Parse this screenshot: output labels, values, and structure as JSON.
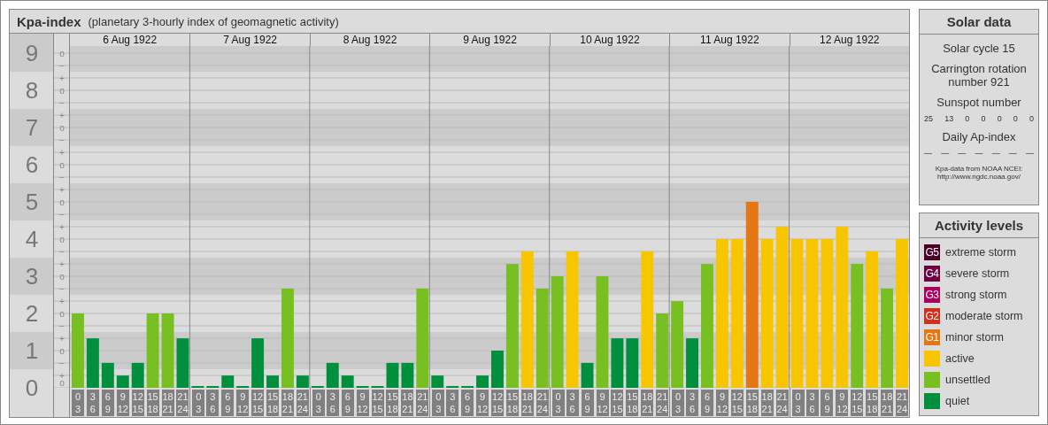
{
  "main": {
    "subtitle": "(planetary 3-hourly index of geomagnetic activity)",
    "days": [
      {
        "date": "6 Aug 1922"
      },
      {
        "date": "7 Aug 1922"
      },
      {
        "date": "8 Aug 1922"
      },
      {
        "date": "9 Aug 1922"
      },
      {
        "date": "10 Aug 1922"
      },
      {
        "date": "11 Aug 1922"
      },
      {
        "date": "12 Aug 1922"
      }
    ],
    "minor_ticks": [
      "o",
      "−",
      "+",
      "o",
      "−",
      "+",
      "o",
      "−",
      "+",
      "o",
      "−",
      "+",
      "o",
      "−",
      "+",
      "o",
      "−",
      "+",
      "o",
      "−",
      "+",
      "o",
      "−",
      "+",
      "o",
      "−",
      "+",
      "o"
    ],
    "chart_data": {
      "type": "bar",
      "title": "Kpa-index",
      "ylim": [
        0,
        9.19
      ],
      "yticks": [
        0,
        1,
        2,
        3,
        4,
        5,
        6,
        7,
        8,
        9
      ],
      "grid": true,
      "categories": [
        "0 3",
        "3 6",
        "6 9",
        "9 12",
        "12 15",
        "15 18",
        "18 21",
        "21 24",
        "0 3",
        "3 6",
        "6 9",
        "9 12",
        "12 15",
        "15 18",
        "18 21",
        "21 24",
        "0 3",
        "3 6",
        "6 9",
        "9 12",
        "12 15",
        "15 18",
        "18 21",
        "21 24",
        "0 3",
        "3 6",
        "6 9",
        "9 12",
        "12 15",
        "15 18",
        "18 21",
        "21 24",
        "0 3",
        "3 6",
        "6 9",
        "9 12",
        "12 15",
        "15 18",
        "18 21",
        "21 24",
        "0 3",
        "3 6",
        "6 9",
        "9 12",
        "12 15",
        "15 18",
        "18 21",
        "21 24",
        "0 3",
        "3 6",
        "6 9",
        "9 12",
        "12 15",
        "15 18",
        "18 21",
        "21 24"
      ],
      "values": [
        2,
        1.33,
        0.67,
        0.33,
        0.67,
        2,
        2,
        1.33,
        0,
        0,
        0.33,
        0,
        1.33,
        0.33,
        2.67,
        0.33,
        0,
        0.67,
        0.33,
        0,
        0,
        0.67,
        0.67,
        2.67,
        0.33,
        0,
        0,
        0.33,
        1,
        3.33,
        3.67,
        2.67,
        3,
        3.67,
        0.67,
        3,
        1.33,
        1.33,
        3.67,
        2,
        2.33,
        1.33,
        3.33,
        4,
        4,
        5,
        4,
        4.33,
        4,
        4,
        4,
        4.33,
        3.33,
        3.67,
        2.67,
        4
      ]
    }
  },
  "solar_data": {
    "title": "Solar data",
    "cycle": "Solar cycle 15",
    "rotation": "Carrington rotation number 921",
    "sunspot_label": "Sunspot number",
    "sunspots": [
      "25",
      "13",
      "0",
      "0",
      "0",
      "0",
      "0"
    ],
    "ap_label": "Daily Ap-index",
    "ap_values": [
      "—",
      "—",
      "—",
      "—",
      "—",
      "—",
      "—"
    ],
    "source": "Kpa-data from NOAA NCEI: http://www.ngdc.noaa.gov/"
  },
  "activity_levels": {
    "title": "Activity levels",
    "items": [
      {
        "badge": "G5",
        "label": "extreme storm",
        "color": "#4d0026"
      },
      {
        "badge": "G4",
        "label": "severe storm",
        "color": "#6e0042"
      },
      {
        "badge": "G3",
        "label": "strong storm",
        "color": "#a8005c"
      },
      {
        "badge": "G2",
        "label": "moderate storm",
        "color": "#d0301c"
      },
      {
        "badge": "G1",
        "label": "minor storm",
        "color": "#e47713"
      },
      {
        "label": "active",
        "color": "#f8c600"
      },
      {
        "label": "unsettled",
        "color": "#78bf22"
      },
      {
        "label": "quiet",
        "color": "#008f3c"
      }
    ]
  }
}
